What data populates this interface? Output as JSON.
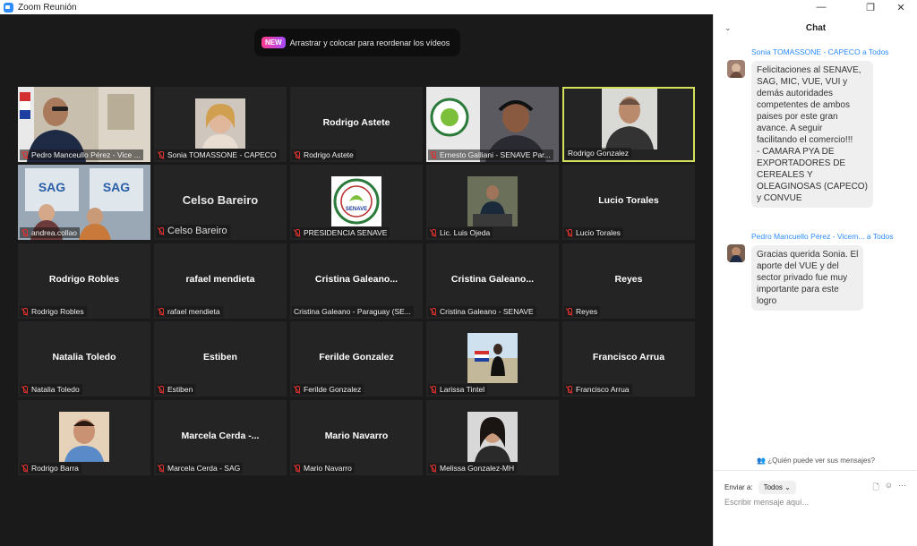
{
  "window": {
    "title": "Zoom Reunión",
    "minimize": "—",
    "restore": "❐",
    "close": "✕"
  },
  "toast": {
    "badge": "NEW",
    "text": "Arrastrar y colocar para reordenar los vídeos"
  },
  "tiles": [
    {
      "label": "Pedro Manceullo Pérez - Vice ...",
      "video": true
    },
    {
      "label": "Sonia TOMASSONE - CAPECO",
      "video": true
    },
    {
      "name": "Rodrigo Astete",
      "label": "Rodrigo Astete"
    },
    {
      "label": "Ernesto Galliani - SENAVE Par...",
      "video": true
    },
    {
      "label": "Rodrigo Gonzalez",
      "video": true,
      "active": true
    },
    {
      "label": "andrea.collao",
      "video": true
    },
    {
      "name": "Celso Bareiro",
      "label": "Celso Bareiro"
    },
    {
      "label": "PRESIDENCIA SENAVE",
      "video": true
    },
    {
      "label": "Lic. Luis Ojeda",
      "video": true
    },
    {
      "name": "Lucio Torales",
      "label": "Lucio Torales"
    },
    {
      "name": "Rodrigo Robles",
      "label": "Rodrigo Robles"
    },
    {
      "name": "rafael mendieta",
      "label": "rafael mendieta"
    },
    {
      "name": "Cristina  Galeano...",
      "label": "Cristina Galeano - Paraguay (SE..."
    },
    {
      "name": "Cristina  Galeano...",
      "label": "Cristina Galeano -  SENAVE"
    },
    {
      "name": "Reyes",
      "label": "Reyes"
    },
    {
      "name": "Natalia Toledo",
      "label": "Natalia Toledo"
    },
    {
      "name": "Estiben",
      "label": "Estiben"
    },
    {
      "name": "Ferilde Gonzalez",
      "label": "Ferilde Gonzalez"
    },
    {
      "label": "Larissa Tintel",
      "video": true
    },
    {
      "name": "Francisco Arrua",
      "label": "Francisco Arrua"
    },
    {
      "label": "Rodrigo Barra",
      "video": true
    },
    {
      "name": "Marcela  Cerda  -...",
      "label": "Marcela Cerda - SAG"
    },
    {
      "name": "Mario Navarro",
      "label": "Mario Navarro"
    },
    {
      "label": "Melissa Gonzalez-MH",
      "video": true
    }
  ],
  "sag_text": "SAG",
  "senave_logo_text": "SENAVE",
  "chat": {
    "title": "Chat",
    "collapse_icon": "⌄",
    "messages": [
      {
        "sender": "Sonia TOMASSONE - CAPECO",
        "to": "a Todos",
        "lines": [
          "Felicitaciones al SENAVE,",
          "SAG, MIC, VUE, VUI y",
          "demás autoridades",
          "competentes de ambos",
          "paises por este gran",
          "avance. A seguir",
          "facilitando el comercio!!!",
          "- CAMARA PYA DE",
          "EXPORTADORES DE",
          "CEREALES Y",
          "OLEAGINOSAS (CAPECO)",
          "y CONVUE"
        ]
      },
      {
        "sender": "Pedro Mancuello Pérez - Vicem...",
        "to": "a Todos",
        "lines": [
          "Gracias querida Sonia. El",
          "aporte del VUE y del",
          "sector privado fue muy",
          "importante para este",
          "logro"
        ]
      }
    ],
    "visibility": "¿Quién puede ver sus mensajes?",
    "send_to_label": "Enviar a:",
    "send_to_value": "Todos",
    "send_to_chevron": "⌄",
    "tool_file": "🗋",
    "tool_emoji": "☺",
    "tool_more": "···",
    "placeholder": "Escribir mensaje aquí..."
  },
  "colors": {
    "accent": "#2d8cff",
    "active_border": "#d4e15b",
    "mute": "#e03131"
  }
}
